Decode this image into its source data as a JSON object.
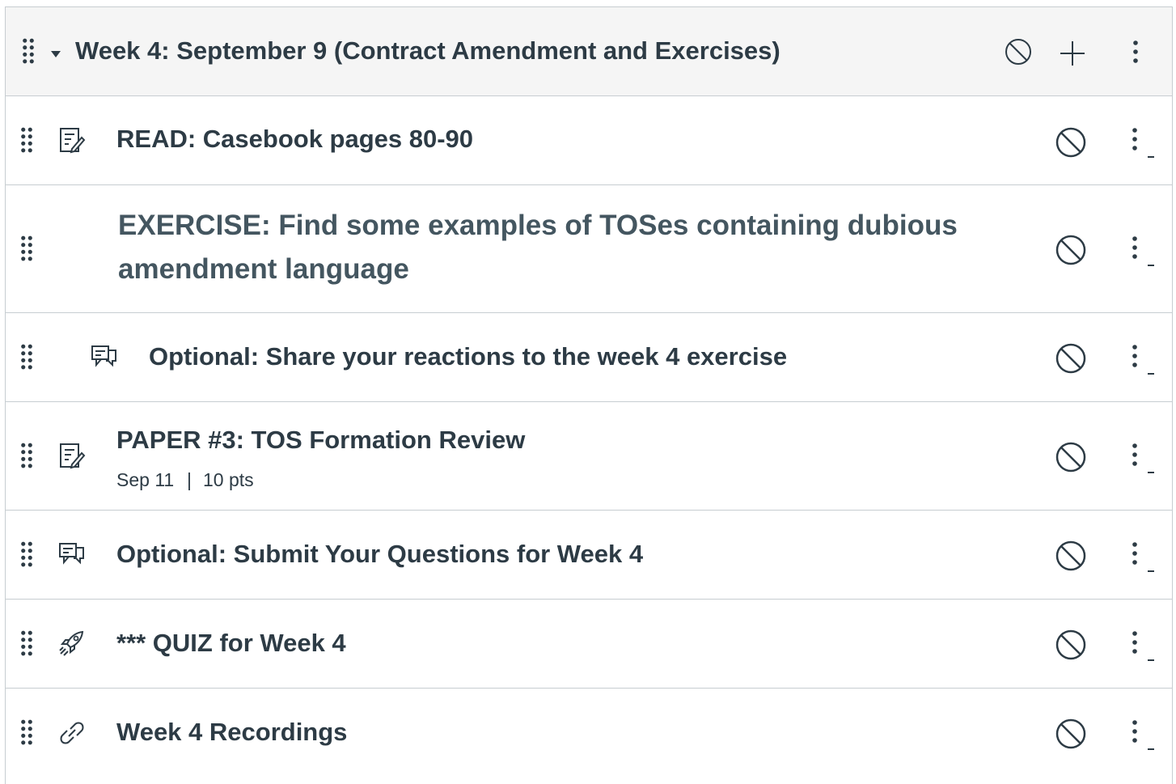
{
  "module": {
    "title": "Week 4: September 9 (Contract Amendment and Exercises)",
    "header_icons": [
      "drag-handle-icon",
      "caret-down-icon",
      "unpublished-icon",
      "add-icon",
      "kebab-menu-icon"
    ]
  },
  "items": [
    {
      "type": "assignment",
      "icon": "assignment-icon",
      "title": "READ: Casebook pages 80-90"
    },
    {
      "type": "subheader",
      "icon": "",
      "title_line1": "EXERCISE: Find some examples of TOSes containing dubious",
      "title_line2": "amendment language"
    },
    {
      "type": "discussion",
      "icon": "discussion-icon",
      "title": "Optional: Share your reactions to the week 4 exercise"
    },
    {
      "type": "assignment",
      "icon": "assignment-icon",
      "title": "PAPER #3: TOS Formation Review",
      "due": "Sep 11",
      "separator": "|",
      "points": "10 pts"
    },
    {
      "type": "discussion",
      "icon": "discussion-icon",
      "title": "Optional: Submit Your Questions for Week 4"
    },
    {
      "type": "quiz",
      "icon": "quiz-icon",
      "title": "*** QUIZ for Week 4"
    },
    {
      "type": "link",
      "icon": "link-icon",
      "title": "Week 4 Recordings"
    }
  ],
  "colors": {
    "text": "#2d3b45",
    "border": "#c7cdd1",
    "header_bg": "#f5f5f5"
  }
}
